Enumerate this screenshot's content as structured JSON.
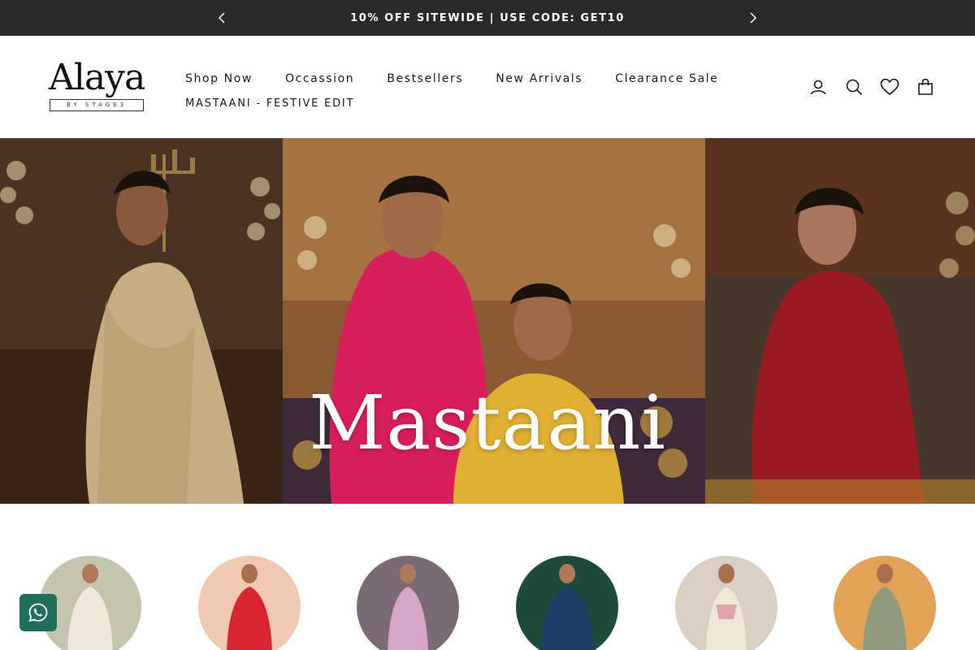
{
  "announcement": {
    "message": "10% OFF SITEWIDE | USE CODE: GET10"
  },
  "logo": {
    "wordmark": "Alaya",
    "tagline": "BY STAGE3"
  },
  "nav": {
    "row1": [
      "Shop Now",
      "Occassion",
      "Bestsellers",
      "New Arrivals",
      "Clearance Sale"
    ],
    "row2": [
      "MASTAANI - FESTIVE EDIT"
    ]
  },
  "header_icons": [
    "account-icon",
    "search-icon",
    "wishlist-heart-icon",
    "cart-bag-icon"
  ],
  "hero": {
    "title": "Mastaani"
  },
  "categories": [
    {
      "name": "category-1",
      "bg": "#d9d2c2",
      "dress": "#efe8da"
    },
    {
      "name": "category-2",
      "bg": "#f1c9b2",
      "dress": "#d8252f"
    },
    {
      "name": "category-3",
      "bg": "#7a6a74",
      "dress": "#d7a6c6"
    },
    {
      "name": "category-4",
      "bg": "#1e4a3a",
      "dress": "#1c3f66"
    },
    {
      "name": "category-5",
      "bg": "#d9cfc2",
      "dress": "#efe6d6"
    },
    {
      "name": "category-6",
      "bg": "#e3a357",
      "dress": "#8f9a7e"
    }
  ],
  "colors": {
    "announce_bg": "#2a2a2a",
    "whatsapp": "#1f6f5c"
  }
}
